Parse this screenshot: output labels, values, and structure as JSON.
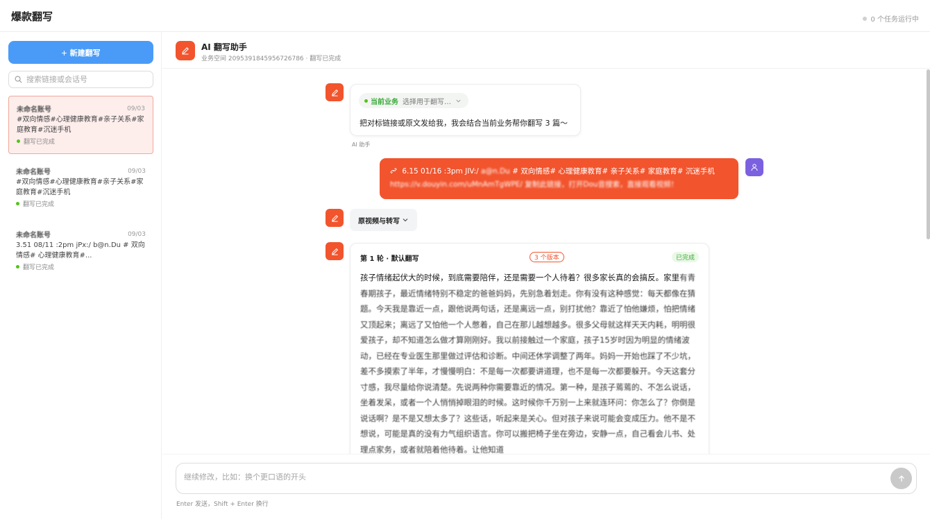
{
  "app": {
    "title": "爆款翻写",
    "task_status": "0 个任务运行中"
  },
  "sidebar": {
    "new_button": "新建翻写",
    "search_placeholder": "搜索链接或会话号",
    "conversations": [
      {
        "name": "未命名账号",
        "date": "09/03",
        "preview": "#双向情感#心理健康教育#亲子关系#家庭教育#沉迷手机",
        "status": "翻写已完成",
        "active": true
      },
      {
        "name": "未命名账号",
        "date": "09/03",
        "preview": "#双向情感#心理健康教育#亲子关系#家庭教育#沉迷手机",
        "status": "翻写已完成",
        "active": false
      },
      {
        "name": "未命名账号",
        "date": "09/03",
        "preview": "3.51 08/11 :2pm jPx:/ b@n.Du # 双向情感# 心理健康教育#...",
        "status": "翻写已完成",
        "active": false
      }
    ]
  },
  "header": {
    "title": "AI 翻写助手",
    "subtitle": "业务空间 2095391845956726786 · 翻写已完成"
  },
  "chat": {
    "assistant_greeting": {
      "current_business_label": "当前业务",
      "select_placeholder": "选择用于翻写…",
      "text": "把对标链接或原文发给我，我会结合当前业务帮你翻写 3 篇～",
      "sender": "AI 助手"
    },
    "user_message": {
      "line1_prefix": "6.15 01/16 :3pm JIV:/",
      "line1_blurred": "a@n.Du",
      "line1_suffix": "# 双向情感# 心理健康教育# 亲子关系# 家庭教育# 沉迷手机",
      "line2": "https://v.douyin.com/uMnAmTgWPE/ 复制此链接，打开Dou音搜索，直接观看视频！"
    },
    "chip_label": "原视频与转写",
    "result_card": {
      "round_label": "第 1 轮 · 默认翻写",
      "versions_badge": "3 个版本",
      "done_badge": "已完成",
      "first_line": "孩子情绪起伏大的时候，到底需要陪伴，还是需要一个人待着？很多家长真的会搞反。家里",
      "body": "有青春期孩子，最近情绪特别不稳定的爸爸妈妈，先别急着划走。你有没有这种感觉：每天都像在猜题。今天我是靠近一点，跟他说两句话，还是离远一点，别打扰他？靠近了怕他嫌烦，怕把情绪又顶起来；离远了又怕他一个人憋着，自己在那儿越想越多。很多父母就这样天天内耗，明明很爱孩子，却不知道怎么做才算刚刚好。我以前接触过一个家庭，孩子15岁时因为明显的情绪波动，已经在专业医生那里做过评估和诊断。中间还休学调整了两年。妈妈一开始也踩了不少坑，差不多摸索了半年，才慢慢明白：不是每一次都要讲道理，也不是每一次都要躲开。今天这套分寸感，我尽量给你说清楚。先说两种你需要靠近的情况。第一种，是孩子蔫蔫的、不怎么说话，坐着发呆，或者一个人悄悄掉眼泪的时候。这时候你千万别一上来就连环问：你怎么了？你倒是说话啊？是不是又想太多了？这些话，听起来是关心。但对孩子来说可能会变成压力。他不是不想说，可能是真的没有力气组织语言。你可以搬把椅子坐在旁边，安静一点，自己看会儿书、处理点家务，或者就陪着他待着。让他知道"
    }
  },
  "composer": {
    "placeholder": "继续修改，比如：换个更口语的开头",
    "hint": "Enter 发送，Shift + Enter 换行"
  },
  "colors": {
    "accent": "#f2542d",
    "primary_button": "#4a9bf7",
    "success": "#3cab3c",
    "avatar": "#7b61e0"
  },
  "icons": {
    "agent": "pen-icon",
    "user": "user-icon",
    "search": "search-icon",
    "send": "arrow-up-icon",
    "link": "link-icon"
  }
}
